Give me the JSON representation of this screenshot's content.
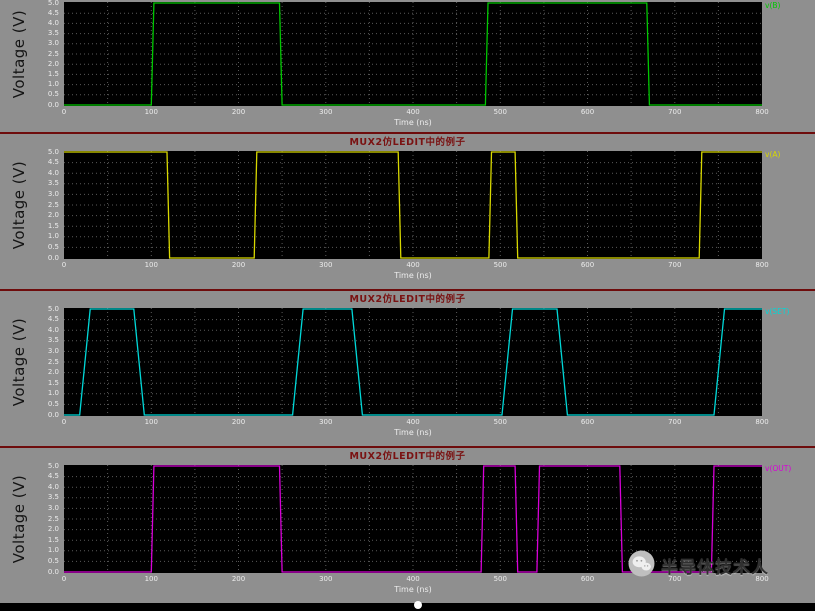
{
  "app": {
    "name": "waveform-viewer"
  },
  "watermark": {
    "text": "半导体技术人"
  },
  "axis": {
    "y_label": "Voltage (V)",
    "x_label": "Time (ns)",
    "x_range": [
      0,
      800
    ],
    "y_range": [
      0,
      5
    ],
    "x_ticks": [
      0,
      100,
      200,
      300,
      400,
      500,
      600,
      700,
      800
    ],
    "y_ticks": [
      "5.0",
      "4.5",
      "4.0",
      "3.5",
      "3.0",
      "2.5",
      "2.0",
      "1.5",
      "1.0",
      "0.5",
      "0.0"
    ],
    "x_minor_step": 50,
    "grid": true,
    "grid_color": "#5a5a5a"
  },
  "chart_data": [
    {
      "type": "line",
      "name": "v(B)",
      "panel_title": "",
      "color": "#00c800",
      "xlabel": "Time (ns)",
      "ylabel": "Voltage (V)",
      "xlim": [
        0,
        800
      ],
      "ylim": [
        0,
        5
      ],
      "legend_position": "top-right",
      "points": [
        [
          0,
          0
        ],
        [
          100,
          0
        ],
        [
          103,
          5
        ],
        [
          247,
          5
        ],
        [
          250,
          0
        ],
        [
          483,
          0
        ],
        [
          486,
          5
        ],
        [
          668,
          5
        ],
        [
          671,
          0
        ],
        [
          800,
          0
        ]
      ]
    },
    {
      "type": "line",
      "name": "v(A)",
      "panel_title": "MUX2仿LEDIT中的例子",
      "color": "#d8d800",
      "xlabel": "Time (ns)",
      "ylabel": "Voltage (V)",
      "xlim": [
        0,
        800
      ],
      "ylim": [
        0,
        5
      ],
      "legend_position": "top-right",
      "points": [
        [
          0,
          5
        ],
        [
          118,
          5
        ],
        [
          121,
          0
        ],
        [
          218,
          0
        ],
        [
          221,
          5
        ],
        [
          383,
          5
        ],
        [
          386,
          0
        ],
        [
          487,
          0
        ],
        [
          490,
          5
        ],
        [
          517,
          5
        ],
        [
          520,
          0
        ],
        [
          728,
          0
        ],
        [
          731,
          5
        ],
        [
          800,
          5
        ]
      ]
    },
    {
      "type": "line",
      "name": "v(SET)",
      "panel_title": "MUX2仿LEDIT中的例子",
      "color": "#00d8d8",
      "xlabel": "Time (ns)",
      "ylabel": "Voltage (V)",
      "xlim": [
        0,
        800
      ],
      "ylim": [
        0,
        5
      ],
      "legend_position": "top-right",
      "points": [
        [
          0,
          0
        ],
        [
          18,
          0
        ],
        [
          30,
          5
        ],
        [
          80,
          5
        ],
        [
          92,
          0
        ],
        [
          262,
          0
        ],
        [
          274,
          5
        ],
        [
          330,
          5
        ],
        [
          342,
          0
        ],
        [
          502,
          0
        ],
        [
          514,
          5
        ],
        [
          565,
          5
        ],
        [
          577,
          0
        ],
        [
          745,
          0
        ],
        [
          757,
          5
        ],
        [
          800,
          5
        ]
      ]
    },
    {
      "type": "line",
      "name": "v(OUT)",
      "panel_title": "MUX2仿LEDIT中的例子",
      "color": "#d800d8",
      "xlabel": "Time (ns)",
      "ylabel": "Voltage (V)",
      "xlim": [
        0,
        800
      ],
      "ylim": [
        0,
        5
      ],
      "legend_position": "top-right",
      "points": [
        [
          0,
          0
        ],
        [
          100,
          0
        ],
        [
          103,
          5
        ],
        [
          247,
          5
        ],
        [
          250,
          0
        ],
        [
          478,
          0
        ],
        [
          481,
          5
        ],
        [
          517,
          5
        ],
        [
          520,
          0
        ],
        [
          542,
          0
        ],
        [
          545,
          5
        ],
        [
          637,
          5
        ],
        [
          640,
          0
        ],
        [
          742,
          0
        ],
        [
          745,
          5
        ],
        [
          800,
          5
        ]
      ]
    }
  ]
}
